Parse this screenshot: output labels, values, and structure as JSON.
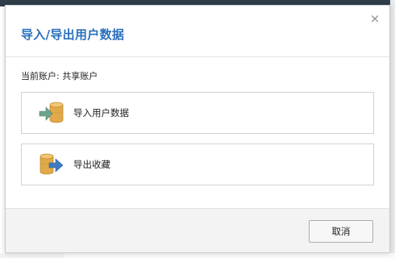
{
  "dialog": {
    "title": "导入/导出用户数据",
    "close_glyph": "×",
    "account_line": "当前账户: 共享账户",
    "options": [
      {
        "label": "导入用户数据",
        "icon": "database-import-icon"
      },
      {
        "label": "导出收藏",
        "icon": "database-export-icon"
      }
    ],
    "cancel_label": "取消"
  },
  "colors": {
    "title": "#2a6fbd",
    "db_gold": "#e0a94a",
    "import_arrow": "#6fa38c",
    "export_arrow": "#3f7bc1"
  }
}
